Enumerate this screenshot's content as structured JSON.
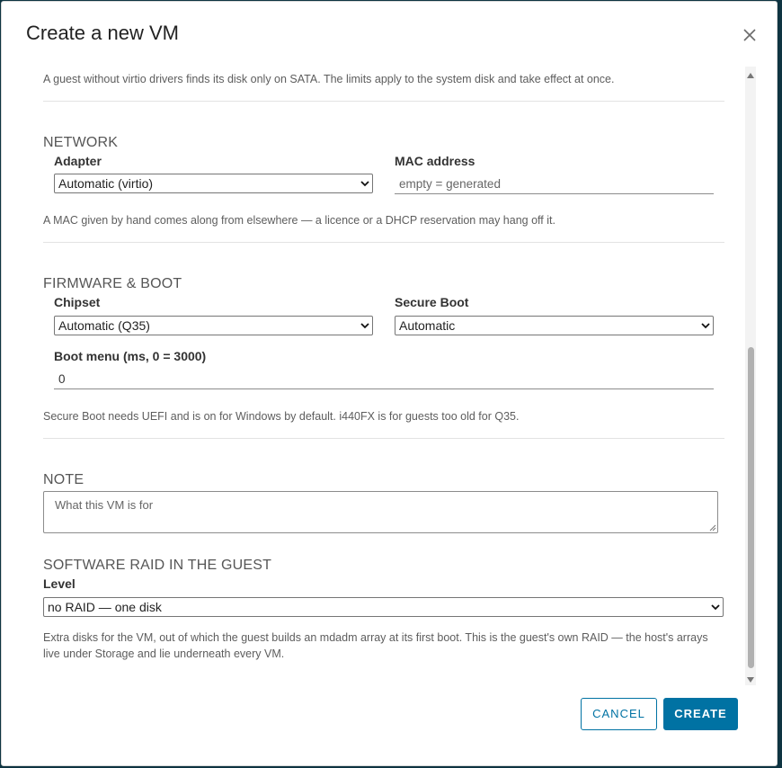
{
  "dialog": {
    "title": "Create a new VM",
    "close_icon": "close-icon"
  },
  "disk": {
    "hint": "A guest without virtio drivers finds its disk only on SATA. The limits apply to the system disk and take effect at once."
  },
  "network": {
    "title": "NETWORK",
    "adapter_label": "Adapter",
    "adapter_value": "Automatic (virtio)",
    "mac_label": "MAC address",
    "mac_placeholder": "empty = generated",
    "hint": "A MAC given by hand comes along from elsewhere — a licence or a DHCP reservation may hang off it."
  },
  "firmware": {
    "title": "FIRMWARE & BOOT",
    "chipset_label": "Chipset",
    "chipset_value": "Automatic (Q35)",
    "secure_boot_label": "Secure Boot",
    "secure_boot_value": "Automatic",
    "boot_menu_label": "Boot menu (ms, 0 = 3000)",
    "boot_menu_value": "0",
    "hint": "Secure Boot needs UEFI and is on for Windows by default. i440FX is for guests too old for Q35."
  },
  "note": {
    "title": "NOTE",
    "placeholder": "What this VM is for"
  },
  "raid": {
    "title": "SOFTWARE RAID IN THE GUEST",
    "level_label": "Level",
    "level_value": "no RAID — one disk",
    "hint": "Extra disks for the VM, out of which the guest builds an mdadm array at its first boot. This is the guest's own RAID — the host's arrays live under Storage and lie underneath every VM."
  },
  "footer": {
    "cancel_label": "CANCEL",
    "create_label": "CREATE"
  },
  "colors": {
    "accent": "#0072a3",
    "backdrop": "#0e3441"
  }
}
